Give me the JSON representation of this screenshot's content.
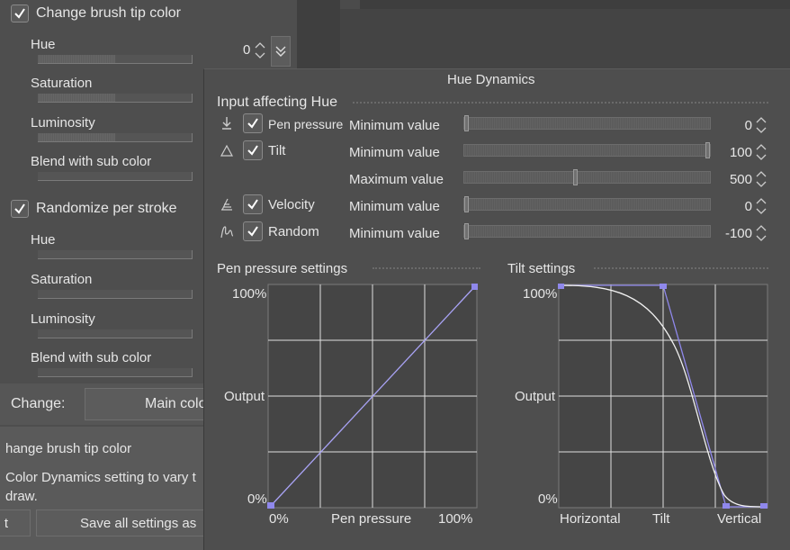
{
  "left_panel": {
    "change_tip": {
      "label": "Change brush tip color",
      "checked": true
    },
    "hue_label": "Hue",
    "hue_value": "0",
    "saturation_label": "Saturation",
    "luminosity_label": "Luminosity",
    "blend_label": "Blend with sub color",
    "randomize": {
      "label": "Randomize per stroke",
      "checked": true
    },
    "r_hue_label": "Hue",
    "r_saturation_label": "Saturation",
    "r_luminosity_label": "Luminosity",
    "r_blend_label": "Blend with sub color",
    "change_label": "Change:",
    "change_value": "Main colo",
    "desc_title": "hange brush tip color",
    "desc_line1": "Color Dynamics setting to vary t",
    "desc_line2": "draw.",
    "btn_left": "t",
    "btn_save": "Save all settings as"
  },
  "dialog": {
    "title": "Hue Dynamics",
    "input_section": "Input affecting Hue",
    "rows": [
      {
        "name": "Pen pressure",
        "checked": true,
        "param": "Minimum value",
        "value": "0",
        "level": 0.0
      },
      {
        "name": "Tilt",
        "checked": true,
        "param": "Minimum value",
        "value": "100",
        "level": 1.0
      },
      {
        "name": "",
        "checked": null,
        "param": "Maximum value",
        "value": "500",
        "level": 0.45
      },
      {
        "name": "Velocity",
        "checked": true,
        "param": "Minimum value",
        "value": "0",
        "level": 0.0
      },
      {
        "name": "Random",
        "checked": true,
        "param": "Minimum value",
        "value": "-100",
        "level": 0.0
      }
    ],
    "pen_settings": {
      "title": "Pen pressure settings",
      "y_top": "100%",
      "y_mid": "Output",
      "y_bot": "0%",
      "x_left": "0%",
      "x_mid": "Pen pressure",
      "x_right": "100%"
    },
    "tilt_settings": {
      "title": "Tilt settings",
      "y_top": "100%",
      "y_mid": "Output",
      "y_bot": "0%",
      "x_left": "Horizontal",
      "x_mid": "Tilt",
      "x_right": "Vertical"
    },
    "curve_color": "#9a94f0"
  }
}
